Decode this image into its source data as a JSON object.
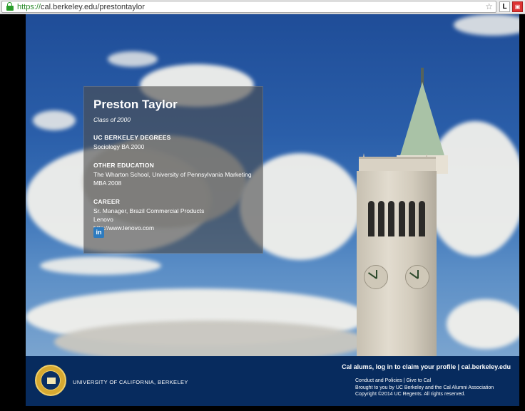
{
  "browser": {
    "url_scheme": "https://",
    "url_rest": "cal.berkeley.edu/prestontaylor",
    "ext_l_label": "L"
  },
  "profile": {
    "name": "Preston Taylor",
    "class_year": "Class of 2000",
    "degrees_title": "UC BERKELEY DEGREES",
    "degrees": [
      "Sociology BA 2000"
    ],
    "other_edu_title": "OTHER EDUCATION",
    "other_edu": [
      "The Wharton School, University of Pennsylvania Marketing",
      "MBA 2008"
    ],
    "career_title": "CAREER",
    "career": [
      "Sr. Manager, Brazil Commercial Products",
      "Lenovo",
      "http://www.lenovo.com"
    ],
    "linkedin_label": "in"
  },
  "footer": {
    "university": "UNIVERSITY OF CALIFORNIA, BERKELEY",
    "claim": "Cal alums, log in to claim your profile | cal.berkeley.edu",
    "conduct_link": "Conduct and Policies",
    "sep": " | ",
    "give_link": "Give to Cal",
    "brought": "Brought to you by UC Berkeley and the Cal Alumni Association",
    "copyright": "Copyright ©2014 UC Regents. All rights reserved."
  },
  "colors": {
    "footer_bg": "#072b5e",
    "secure_green": "#2a8a2a",
    "linkedin_blue": "#2d7bbf"
  }
}
